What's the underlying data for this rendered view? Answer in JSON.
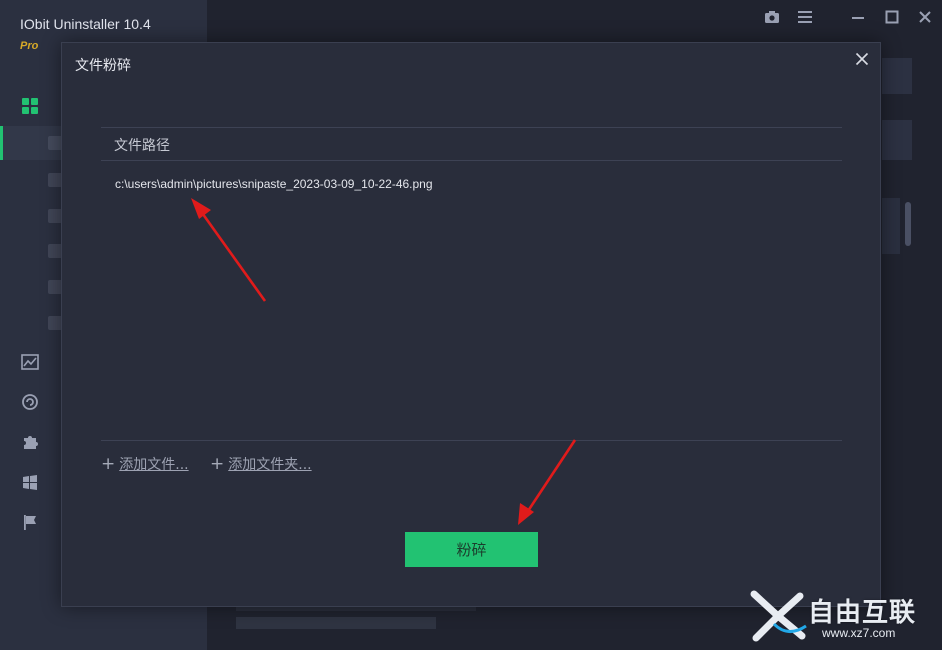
{
  "app": {
    "title": "IObit Uninstaller 10.4",
    "edition": "Pro"
  },
  "dialog": {
    "title": "文件粉碎",
    "close_icon": "close-icon",
    "table": {
      "header": "文件路径",
      "rows": [
        {
          "path": "c:\\users\\admin\\pictures\\snipaste_2023-03-09_10-22-46.png"
        }
      ]
    },
    "add_file_label": "添加文件...",
    "add_folder_label": "添加文件夹...",
    "shred_button": "粉碎"
  },
  "watermark": {
    "text": "自由互联",
    "url": "www.xz7.com"
  },
  "colors": {
    "accent": "#22c272",
    "dialog_bg": "#292d3b",
    "app_bg": "#20232f",
    "sidebar_bg": "#2b3040",
    "arrow": "#e01b1b"
  }
}
